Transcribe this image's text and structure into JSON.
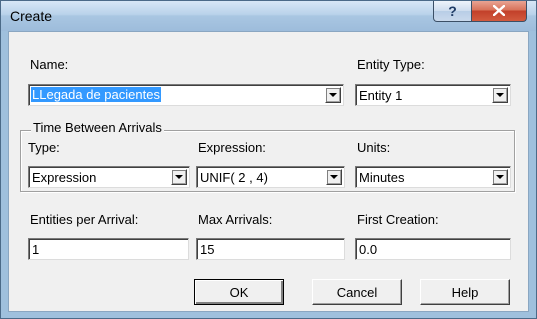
{
  "window": {
    "title": "Create",
    "help_glyph": "?",
    "close_glyph": "x"
  },
  "name": {
    "label": "Name:",
    "value": "LLegada de pacientes"
  },
  "entity_type": {
    "label": "Entity Type:",
    "value": "Entity 1"
  },
  "time_between_arrivals": {
    "group_label": "Time Between Arrivals",
    "type": {
      "label": "Type:",
      "value": "Expression"
    },
    "expression": {
      "label": "Expression:",
      "value": "UNIF( 2 , 4)"
    },
    "units": {
      "label": "Units:",
      "value": "Minutes"
    }
  },
  "entities_per_arrival": {
    "label": "Entities per Arrival:",
    "value": "1"
  },
  "max_arrivals": {
    "label": "Max Arrivals:",
    "value": "15"
  },
  "first_creation": {
    "label": "First Creation:",
    "value": "0.0"
  },
  "buttons": {
    "ok": "OK",
    "cancel": "Cancel",
    "help": "Help"
  },
  "icons": {
    "dropdown": "chevron-down-icon",
    "help": "question-icon",
    "close": "close-icon"
  }
}
